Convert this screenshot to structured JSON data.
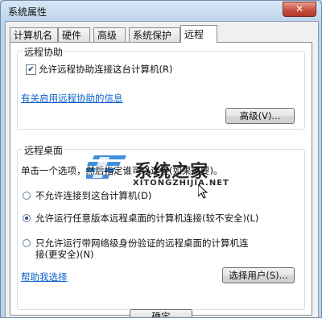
{
  "window": {
    "title": "系统属性",
    "close_glyph": "✕"
  },
  "tabs": [
    {
      "label": "计算机名"
    },
    {
      "label": "硬件"
    },
    {
      "label": "高级"
    },
    {
      "label": "系统保护"
    },
    {
      "label": "远程"
    }
  ],
  "remote_assistance": {
    "title": "远程协助",
    "allow_label": "允许远程协助连接这台计算机(R)",
    "allow_checked": true,
    "info_link": "有关启用远程协助的信息",
    "advanced_button": "高级(V)..."
  },
  "watermark": {
    "text": "系统之家",
    "sub": "XITONGZHIJIA.NET"
  },
  "remote_desktop": {
    "title": "远程桌面",
    "instruction": "单击一个选项，然后指定谁可以连接(如果需要)。",
    "options": [
      {
        "label": "不允许连接到这台计算机(D)",
        "selected": false
      },
      {
        "label": "允许运行任意版本远程桌面的计算机连接(较不安全)(L)",
        "selected": true
      },
      {
        "label_line1": "只允许运行带网络级身份验证的远程桌面的计算机连",
        "label_line2": "接(更安全)(N)",
        "selected": false
      }
    ],
    "help_link": "帮助我选择",
    "select_users_button": "选择用户(S)..."
  },
  "footer": {
    "ok_button": "确定"
  },
  "colors": {
    "link": "#0b60c8",
    "window_frame": "#bcd3ea",
    "close_button": "#c9503e"
  }
}
